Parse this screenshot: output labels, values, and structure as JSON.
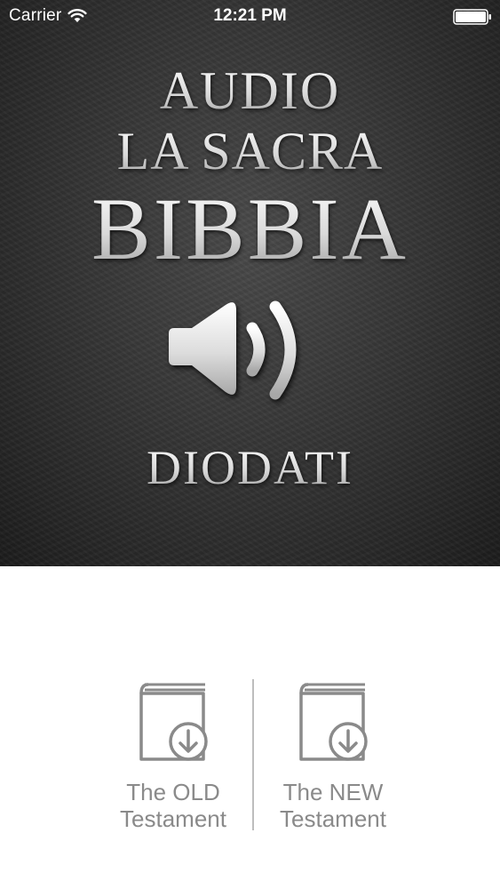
{
  "status_bar": {
    "carrier": "Carrier",
    "time": "12:21 PM"
  },
  "hero": {
    "line1": "AUDIO",
    "line2": "LA SACRA",
    "line3": "BIBBIA",
    "line4": "DIODATI"
  },
  "testaments": {
    "old": {
      "line1": "The OLD",
      "line2": "Testament"
    },
    "new": {
      "line1": "The NEW",
      "line2": "Testament"
    }
  },
  "colors": {
    "hero_background": "#2e2e2e",
    "title_text": "#e2e2e2",
    "icon_gray": "#8a8a8a",
    "divider": "#bdbdbd"
  },
  "icons": [
    "wifi-icon",
    "battery-icon",
    "speaker-icon",
    "book-download-icon"
  ]
}
